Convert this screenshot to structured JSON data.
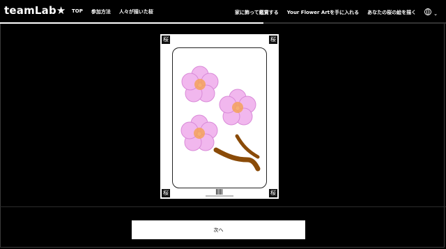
{
  "header": {
    "logo": "teamLab",
    "logo_star": "★",
    "nav_left": [
      "TOP",
      "参加方法",
      "人々が描いた桜"
    ],
    "nav_right": [
      "家に飾って鑑賞する",
      "Your Flower Artを手に入れる",
      "あなたの桜の絵を描く"
    ],
    "language_icon": "globe-icon",
    "dropdown_icon": "chevron-down-icon"
  },
  "progress": {
    "value": 0.59
  },
  "card": {
    "corner_label": "桜",
    "artwork": "cherry-blossom-drawing",
    "colors": {
      "petal": "#f1b7ee",
      "petal_dark": "#d98ad8",
      "center": "#f4a25a",
      "branch": "#8a4b08"
    }
  },
  "footer": {
    "next_label": "次へ"
  }
}
